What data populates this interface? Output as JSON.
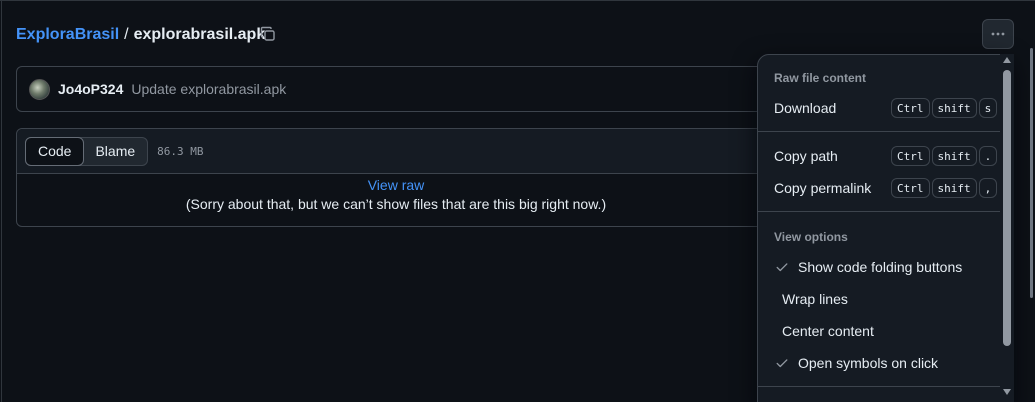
{
  "breadcrumb": {
    "repo": "ExploraBrasil",
    "separator": "/",
    "file": "explorabrasil.apk"
  },
  "commit": {
    "author": "Jo4oP324",
    "message": "Update explorabrasil.apk"
  },
  "file_view": {
    "tabs": [
      "Code",
      "Blame"
    ],
    "active_tab": "Code",
    "size": "86.3 MB",
    "view_raw": "View raw",
    "notice": "(Sorry about that, but we can’t show files that are this big right now.)"
  },
  "menu": {
    "raw_group_title": "Raw file content",
    "download": {
      "label": "Download",
      "keys": [
        "Ctrl",
        "shift",
        "s"
      ]
    },
    "copy_path": {
      "label": "Copy path",
      "keys": [
        "Ctrl",
        "shift",
        "."
      ]
    },
    "copy_permalink": {
      "label": "Copy permalink",
      "keys": [
        "Ctrl",
        "shift",
        ","
      ]
    },
    "view_group_title": "View options",
    "show_folding": {
      "label": "Show code folding buttons",
      "checked": true
    },
    "wrap_lines": {
      "label": "Wrap lines",
      "checked": false
    },
    "center_content": {
      "label": "Center content",
      "checked": false
    },
    "open_symbols": {
      "label": "Open symbols on click",
      "checked": true
    }
  },
  "icons": {
    "copy": "copy-icon",
    "more": "kebab-horizontal-icon",
    "check": "check-icon"
  },
  "colors": {
    "background": "#0d1117",
    "link": "#4493f8",
    "border": "#3d444d",
    "muted": "#9198a1"
  }
}
